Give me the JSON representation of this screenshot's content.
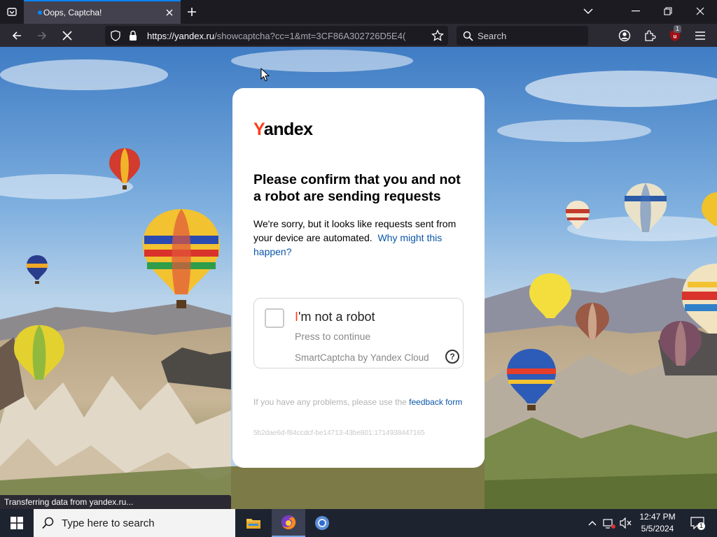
{
  "browser": {
    "tab_title": "Oops, Captcha!",
    "url_main": "https://yandex.ru",
    "url_rest": "/showcaptcha?cc=1&mt=3CF86A302726D5E4(",
    "search_placeholder": "Search",
    "extension_badge": "1",
    "status_text": "Transferring data from yandex.ru..."
  },
  "captcha": {
    "logo_first": "Y",
    "logo_rest": "andex",
    "heading": "Please confirm that you and not a robot are sending requests",
    "description": "We're sorry, but it looks like requests sent from your device are automated.",
    "why_link": "Why might this happen?",
    "checkbox_first": "I",
    "checkbox_rest": "'m not a robot",
    "press_label": "Press to continue",
    "smartcaptcha_label": "SmartCaptcha by Yandex Cloud",
    "help_glyph": "?",
    "feedback_text": "If you have any problems, please use the",
    "feedback_link": "feedback form",
    "request_id": "5b2dae6d-f84ccdcf-be14713-43be801:1714938447165"
  },
  "taskbar": {
    "search_placeholder": "Type here to search",
    "time": "12:47 PM",
    "date": "5/5/2024",
    "notification_count": "1"
  },
  "colors": {
    "brand_red": "#fc3f1d",
    "link_blue": "#0a56a8",
    "accent_blue": "#0a84ff"
  }
}
